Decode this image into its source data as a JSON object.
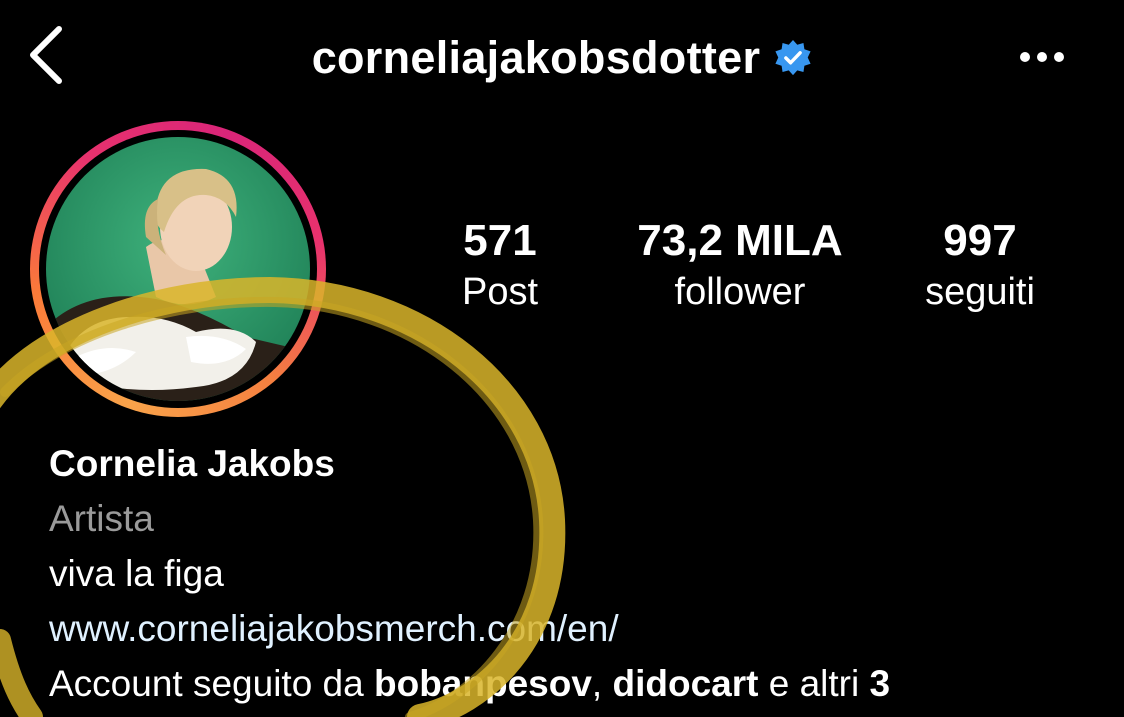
{
  "header": {
    "username": "corneliajakobsdotter",
    "verified": true,
    "back_icon": "chevron-left-icon",
    "more_icon": "more-horizontal-icon"
  },
  "stats": {
    "posts": {
      "value": "571",
      "label": "Post"
    },
    "followers": {
      "value": "73,2 MILA",
      "label": "follower"
    },
    "following": {
      "value": "997",
      "label": "seguiti"
    }
  },
  "bio": {
    "name": "Cornelia Jakobs",
    "category": "Artista",
    "text": "viva la figa",
    "link": "www.corneliajakobsmerch.com/en/",
    "followed_by": {
      "prefix": "Account seguito da ",
      "user1": "bobanpesov",
      "separator": ", ",
      "user2": "didocart",
      "middle": " e altri ",
      "count": "3"
    }
  },
  "colors": {
    "background": "#000000",
    "text": "#ffffff",
    "category_gray": "#9a9a9a",
    "link": "#e0f1ff",
    "verified_blue": "#3897f0",
    "story_ring": [
      "#f9a34a",
      "#e8326d",
      "#d92579"
    ],
    "highlight_marker": "#d9b52a"
  }
}
